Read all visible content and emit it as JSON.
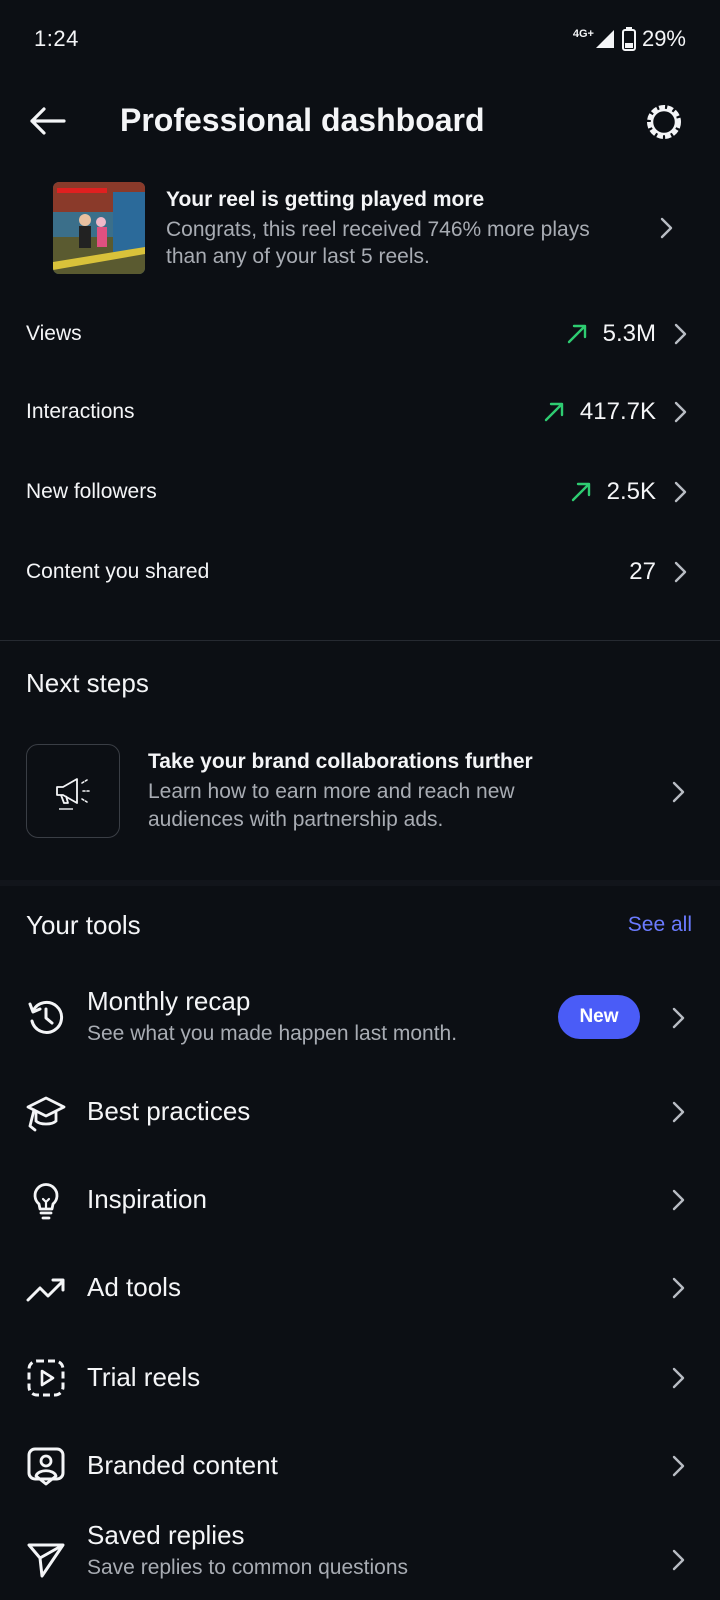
{
  "status_bar": {
    "time": "1:24",
    "network": "4G+",
    "battery": "29%"
  },
  "header": {
    "title": "Professional dashboard"
  },
  "highlight": {
    "title": "Your reel is getting played more",
    "body": "Congrats, this reel received 746% more plays than any of your last 5 reels."
  },
  "stats": [
    {
      "label": "Views",
      "value": "5.3M",
      "trend": "up"
    },
    {
      "label": "Interactions",
      "value": "417.7K",
      "trend": "up"
    },
    {
      "label": "New followers",
      "value": "2.5K",
      "trend": "up"
    },
    {
      "label": "Content you shared",
      "value": "27",
      "trend": "none"
    }
  ],
  "next_steps": {
    "heading": "Next steps",
    "title": "Take your brand collaborations further",
    "body": "Learn how to earn more and reach new audiences with partnership ads."
  },
  "tools": {
    "heading": "Your tools",
    "see_all": "See all",
    "items": [
      {
        "label": "Monthly recap",
        "sub": "See what you made happen last month.",
        "badge": "New",
        "icon": "history-icon"
      },
      {
        "label": "Best practices",
        "icon": "graduation-cap-icon"
      },
      {
        "label": "Inspiration",
        "icon": "lightbulb-icon"
      },
      {
        "label": "Ad tools",
        "icon": "trending-up-icon"
      },
      {
        "label": "Trial reels",
        "icon": "trial-reel-icon"
      },
      {
        "label": "Branded content",
        "icon": "branded-content-icon"
      },
      {
        "label": "Saved replies",
        "sub": "Save replies to common questions",
        "icon": "send-icon"
      }
    ]
  },
  "colors": {
    "background": "#0c0f14",
    "accent": "#4a5cf7",
    "link": "#6b7bff",
    "trend_up": "#2ecc71"
  }
}
